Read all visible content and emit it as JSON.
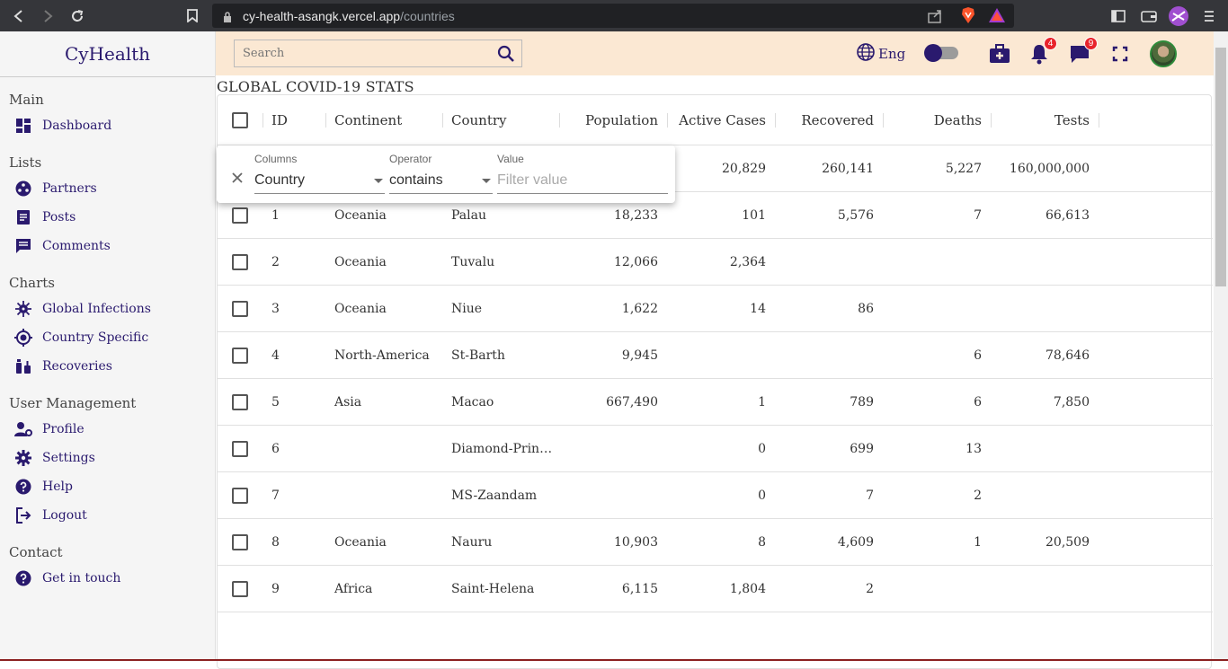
{
  "browser": {
    "url_host": "cy-health-asangk.vercel.app",
    "url_path": "/countries"
  },
  "brand": {
    "logo_text": "CyHealth",
    "accent": "#2a1a6e",
    "header_bg": "#fbe8d3"
  },
  "sidebar": {
    "sections": [
      {
        "title": "Main",
        "items": [
          {
            "label": "Dashboard",
            "icon": "dashboard-icon"
          }
        ]
      },
      {
        "title": "Lists",
        "items": [
          {
            "label": "Partners",
            "icon": "partners-icon"
          },
          {
            "label": "Posts",
            "icon": "posts-icon"
          },
          {
            "label": "Comments",
            "icon": "comments-icon"
          }
        ]
      },
      {
        "title": "Charts",
        "items": [
          {
            "label": "Global Infections",
            "icon": "virus-icon"
          },
          {
            "label": "Country Specific",
            "icon": "target-icon"
          },
          {
            "label": "Recoveries",
            "icon": "vaccine-icon"
          }
        ]
      },
      {
        "title": "User Management",
        "items": [
          {
            "label": "Profile",
            "icon": "user-gear-icon"
          },
          {
            "label": "Settings",
            "icon": "gear-icon"
          },
          {
            "label": "Help",
            "icon": "help-icon"
          },
          {
            "label": "Logout",
            "icon": "logout-icon"
          }
        ]
      },
      {
        "title": "Contact",
        "items": [
          {
            "label": "Get in touch",
            "icon": "help-icon"
          }
        ]
      }
    ]
  },
  "header": {
    "search_placeholder": "Search",
    "language": "Eng",
    "notifications_count": "4",
    "messages_count": "9"
  },
  "page": {
    "title": "GLOBAL COVID-19 STATS"
  },
  "table": {
    "columns": [
      "ID",
      "Continent",
      "Country",
      "Population",
      "Active Cases",
      "Recovered",
      "Deaths",
      "Tests"
    ],
    "rows": [
      {
        "id": "",
        "continent": "",
        "country": "",
        "population": "",
        "active": "20,829",
        "recovered": "260,141",
        "deaths": "5,227",
        "tests": "160,000,000"
      },
      {
        "id": "1",
        "continent": "Oceania",
        "country": "Palau",
        "population": "18,233",
        "active": "101",
        "recovered": "5,576",
        "deaths": "7",
        "tests": "66,613"
      },
      {
        "id": "2",
        "continent": "Oceania",
        "country": "Tuvalu",
        "population": "12,066",
        "active": "2,364",
        "recovered": "",
        "deaths": "",
        "tests": ""
      },
      {
        "id": "3",
        "continent": "Oceania",
        "country": "Niue",
        "population": "1,622",
        "active": "14",
        "recovered": "86",
        "deaths": "",
        "tests": ""
      },
      {
        "id": "4",
        "continent": "North-America",
        "country": "St-Barth",
        "population": "9,945",
        "active": "",
        "recovered": "",
        "deaths": "6",
        "tests": "78,646"
      },
      {
        "id": "5",
        "continent": "Asia",
        "country": "Macao",
        "population": "667,490",
        "active": "1",
        "recovered": "789",
        "deaths": "6",
        "tests": "7,850"
      },
      {
        "id": "6",
        "continent": "",
        "country": "Diamond-Prin…",
        "population": "",
        "active": "0",
        "recovered": "699",
        "deaths": "13",
        "tests": ""
      },
      {
        "id": "7",
        "continent": "",
        "country": "MS-Zaandam",
        "population": "",
        "active": "0",
        "recovered": "7",
        "deaths": "2",
        "tests": ""
      },
      {
        "id": "8",
        "continent": "Oceania",
        "country": "Nauru",
        "population": "10,903",
        "active": "8",
        "recovered": "4,609",
        "deaths": "1",
        "tests": "20,509"
      },
      {
        "id": "9",
        "continent": "Africa",
        "country": "Saint-Helena",
        "population": "6,115",
        "active": "1,804",
        "recovered": "2",
        "deaths": "",
        "tests": ""
      }
    ]
  },
  "filter": {
    "columns_label": "Columns",
    "columns_value": "Country",
    "operator_label": "Operator",
    "operator_value": "contains",
    "value_label": "Value",
    "value_placeholder": "Filter value"
  }
}
